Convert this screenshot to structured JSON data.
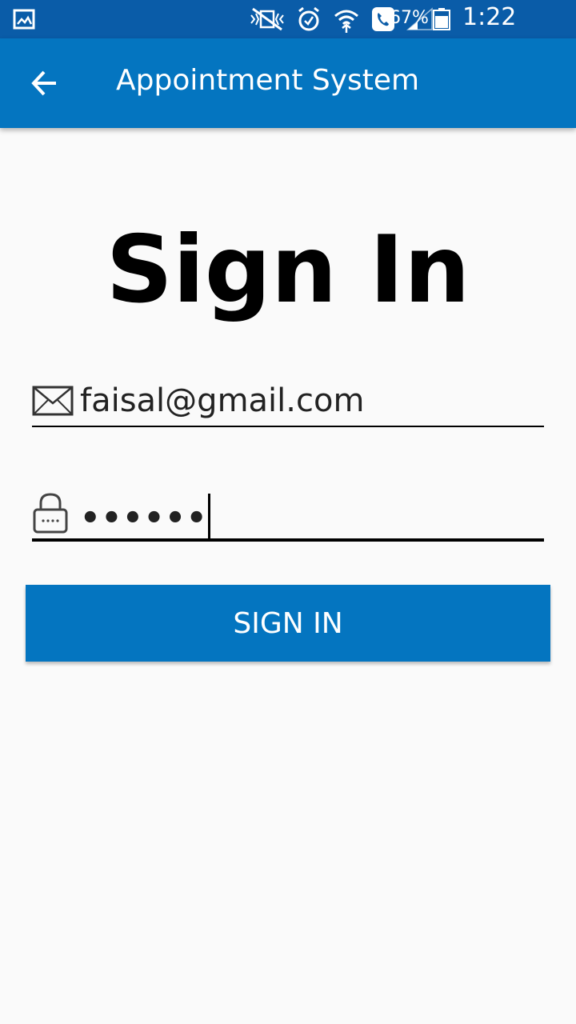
{
  "status_bar": {
    "battery_percent": "67%",
    "time": "1:22 p.m.",
    "icons": [
      "gallery-icon",
      "mute-vibrate-icon",
      "alarm-icon",
      "wifi-icon",
      "call-icon",
      "signal-icon",
      "battery-icon"
    ]
  },
  "app_bar": {
    "title": "Appointment System",
    "back_icon": "arrow-left-icon"
  },
  "form": {
    "heading": "Sign In",
    "email": {
      "value": "faisal@gmail.com",
      "icon": "envelope-icon"
    },
    "password": {
      "value": "••••••",
      "icon": "lock-icon"
    },
    "submit_label": "SIGN IN"
  },
  "colors": {
    "status_bar": "#0a5ca8",
    "app_bar": "#0475c0",
    "button": "#0475c0",
    "background": "#fafafa"
  }
}
